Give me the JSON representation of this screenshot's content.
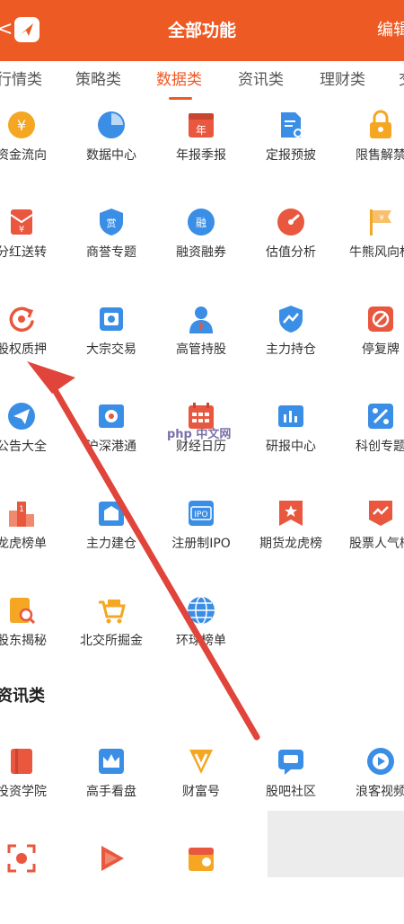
{
  "header": {
    "back": "<",
    "title": "全部功能",
    "edit": "编辑"
  },
  "tabs": [
    "行情类",
    "策略类",
    "数据类",
    "资讯类",
    "理财类",
    "交"
  ],
  "active_tab": 2,
  "grid": [
    [
      "资金流向",
      "数据中心",
      "年报季报",
      "定报预披",
      "限售解禁"
    ],
    [
      "分红送转",
      "商誉专题",
      "融资融券",
      "估值分析",
      "牛熊风向标"
    ],
    [
      "股权质押",
      "大宗交易",
      "高管持股",
      "主力持仓",
      "停复牌"
    ],
    [
      "公告大全",
      "沪深港通",
      "财经日历",
      "研报中心",
      "科创专题"
    ],
    [
      "龙虎榜单",
      "主力建仓",
      "注册制IPO",
      "期货龙虎榜",
      "股票人气榜"
    ],
    [
      "股东揭秘",
      "北交所掘金",
      "环球榜单"
    ]
  ],
  "section2_title": "资讯类",
  "grid2": [
    [
      "投资学院",
      "高手看盘",
      "财富号",
      "股吧社区",
      "浪客视频"
    ]
  ],
  "icon_glyphs": {
    "r0c0": "¥",
    "r0c2": "年",
    "r1c0": "¥",
    "r1c1": "赏",
    "r1c2": "融",
    "r1c4": "¥",
    "r4c0": "1",
    "r4c2": "IPO",
    "r2c4": "⊘"
  },
  "watermark": "php 中文网",
  "colors": {
    "header": "#ee5a24",
    "accent": "#ee5a24",
    "blue": "#3a8ee6",
    "orange": "#f5a623",
    "red": "#e8573e",
    "arrow": "#e0443a"
  }
}
